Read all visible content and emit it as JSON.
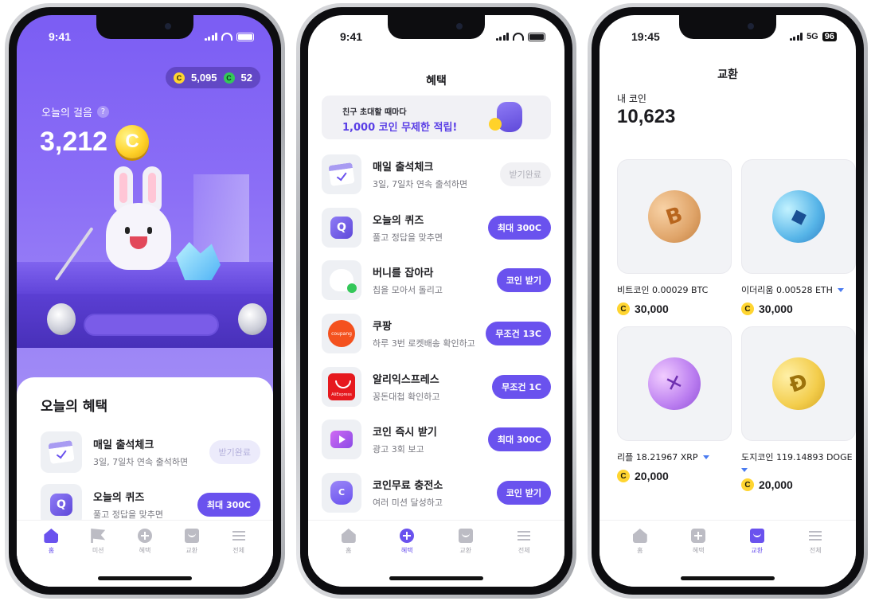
{
  "phone1": {
    "status_time": "9:41",
    "coin_balance": "5,095",
    "green_balance": "52",
    "steps_label": "오늘의 걸음",
    "steps_value": "3,212",
    "section_title": "오늘의 혜택",
    "items": [
      {
        "title": "매일 출석체크",
        "subtitle": "3일, 7일차 연속 출석하면",
        "action": "받기완료",
        "icon": "calendar-check-icon"
      },
      {
        "title": "오늘의 퀴즈",
        "subtitle": "풀고 정답을 맞추면",
        "action": "최대 300C",
        "icon": "quiz-icon"
      }
    ],
    "tabs": [
      {
        "label": "홈",
        "icon": "home-icon",
        "active": true
      },
      {
        "label": "미션",
        "icon": "flag-icon",
        "active": false
      },
      {
        "label": "혜택",
        "icon": "plus-circle-icon",
        "active": false
      },
      {
        "label": "교환",
        "icon": "shopping-bag-icon",
        "active": false
      },
      {
        "label": "전체",
        "icon": "menu-icon",
        "active": false
      }
    ]
  },
  "phone2": {
    "status_time": "9:41",
    "title": "혜택",
    "banner": {
      "line1": "친구 초대할 때마다",
      "line2": "1,000 코인 무제한 적립!"
    },
    "items": [
      {
        "title": "매일 출석체크",
        "subtitle": "3일, 7일차 연속 출석하면",
        "action": "받기완료",
        "icon": "calendar-check-icon"
      },
      {
        "title": "오늘의 퀴즈",
        "subtitle": "풀고 정답을 맞추면",
        "action": "최대 300C",
        "icon": "quiz-icon"
      },
      {
        "title": "버니를 잡아라",
        "subtitle": "칩을 모아서 돌리고",
        "action": "코인 받기",
        "icon": "bunny-icon"
      },
      {
        "title": "쿠팡",
        "subtitle": "하루 3번 로켓배송 확인하고",
        "action": "무조건 13C",
        "icon": "coupang-icon",
        "icon_text": "coupang"
      },
      {
        "title": "알리익스프레스",
        "subtitle": "꽁돈대첩 확인하고",
        "action": "무조건 1C",
        "icon": "aliexpress-icon",
        "icon_text": "AliExpress"
      },
      {
        "title": "코인 즉시 받기",
        "subtitle": "광고 3회 보고",
        "action": "최대 300C",
        "icon": "play-icon"
      },
      {
        "title": "코인무료 충전소",
        "subtitle": "여러 미션 달성하고",
        "action": "코인 받기",
        "icon": "coin-bag-icon"
      }
    ],
    "tabs": [
      {
        "label": "홈",
        "icon": "home-icon",
        "active": false
      },
      {
        "label": "혜택",
        "icon": "plus-circle-icon",
        "active": true
      },
      {
        "label": "교환",
        "icon": "shopping-bag-icon",
        "active": false
      },
      {
        "label": "전체",
        "icon": "menu-icon",
        "active": false
      }
    ]
  },
  "phone3": {
    "status_time": "19:45",
    "network": "5G",
    "battery": "96",
    "title": "교환",
    "my_coin_label": "내 코인",
    "my_coin_value": "10,623",
    "coins": [
      {
        "name": "비트코인 0.00029 BTC",
        "price": "30,000",
        "symbol": "B",
        "icon": "bitcoin-icon",
        "dropdown": false
      },
      {
        "name": "이더리움 0.00528 ETH",
        "price": "30,000",
        "symbol": "◆",
        "icon": "ethereum-icon",
        "dropdown": true
      },
      {
        "name": "리플 18.21967 XRP",
        "price": "20,000",
        "symbol": "✕",
        "icon": "ripple-icon",
        "dropdown": true
      },
      {
        "name": "도지코인 119.14893 DOGE",
        "price": "20,000",
        "symbol": "Ð",
        "icon": "dogecoin-icon",
        "dropdown": true
      }
    ],
    "tabs": [
      {
        "label": "홈",
        "icon": "home-icon",
        "active": false
      },
      {
        "label": "혜택",
        "icon": "plus-square-icon",
        "active": false
      },
      {
        "label": "교환",
        "icon": "shopping-bag-icon",
        "active": true
      },
      {
        "label": "전체",
        "icon": "menu-icon",
        "active": false
      }
    ]
  },
  "colors": {
    "accent": "#6a52ee",
    "coin": "#ffd531"
  }
}
